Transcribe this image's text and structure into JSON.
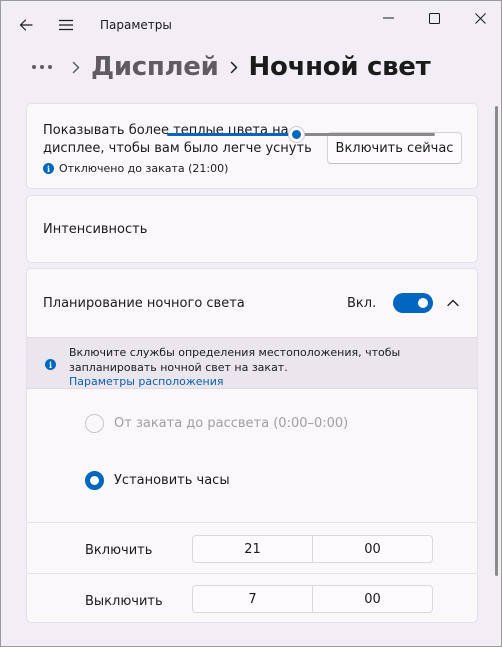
{
  "window": {
    "title": "Параметры"
  },
  "breadcrumb": {
    "parent": "Дисплей",
    "current": "Ночной свет"
  },
  "night_light_card": {
    "description": "Показывать более теплые цвета на дисплее, чтобы вам было легче уснуть",
    "status": "Отключено до заката (21:00)",
    "button_label": "Включить сейчас"
  },
  "intensity_card": {
    "label": "Интенсивность",
    "value_fraction": 0.48
  },
  "schedule_card": {
    "title": "Планирование ночного света",
    "state_label": "Вкл.",
    "toggle_on": true,
    "info_text": "Включите службы определения местоположения, чтобы запланировать ночной свет на закат.",
    "info_link": "Параметры расположения",
    "option_sunset": "От заката до рассвета (0:00–0:00)",
    "option_set_hours": "Установить часы",
    "selected_option": "option_set_hours",
    "turn_on": {
      "label": "Включить",
      "hour": "21",
      "minute": "00"
    },
    "turn_off": {
      "label": "Выключить",
      "hour": "7",
      "minute": "00"
    }
  },
  "colors": {
    "accent": "#0067c0",
    "background": "#f3eef5",
    "card": "#fbf8fc"
  }
}
